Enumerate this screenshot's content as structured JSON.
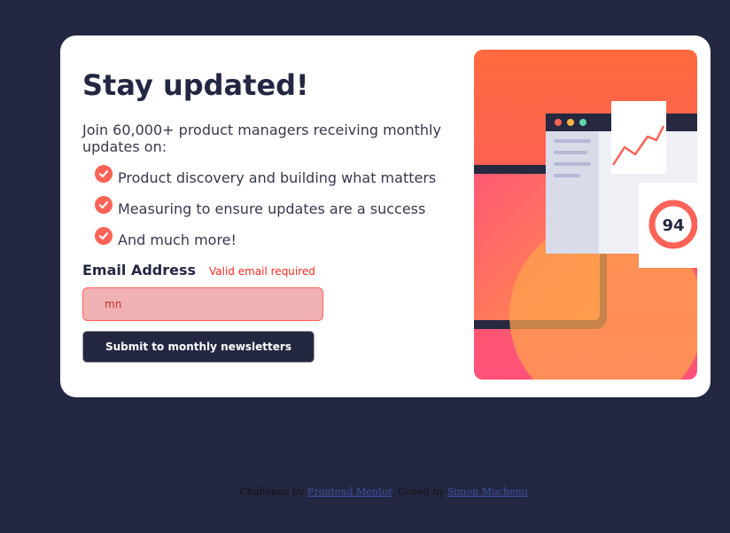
{
  "card": {
    "title": "Stay updated!",
    "lede": "Join 60,000+ product managers receiving monthly updates on:",
    "features": [
      "Product discovery and building what matters",
      "Measuring to ensure updates are a success",
      "And much more!"
    ],
    "email": {
      "label": "Email Address",
      "error": "Valid email required",
      "value": "mn"
    },
    "submit_label": "Submit to monthly newsletters",
    "illustration": {
      "score": "94"
    }
  },
  "footer": {
    "challenge_prefix": "Challenge by",
    "challenge_link": "Frontend Mentor",
    "coded_prefix": ". Coded by",
    "coded_link": "Simon Muchemi"
  },
  "colors": {
    "page_bg": "#242742",
    "accent": "#ff6257",
    "text_dark": "#242742",
    "error": "#ff2a1f",
    "input_invalid_bg": "#efb1b1"
  },
  "icons": {
    "feature_bullet": "check-circle-icon"
  }
}
